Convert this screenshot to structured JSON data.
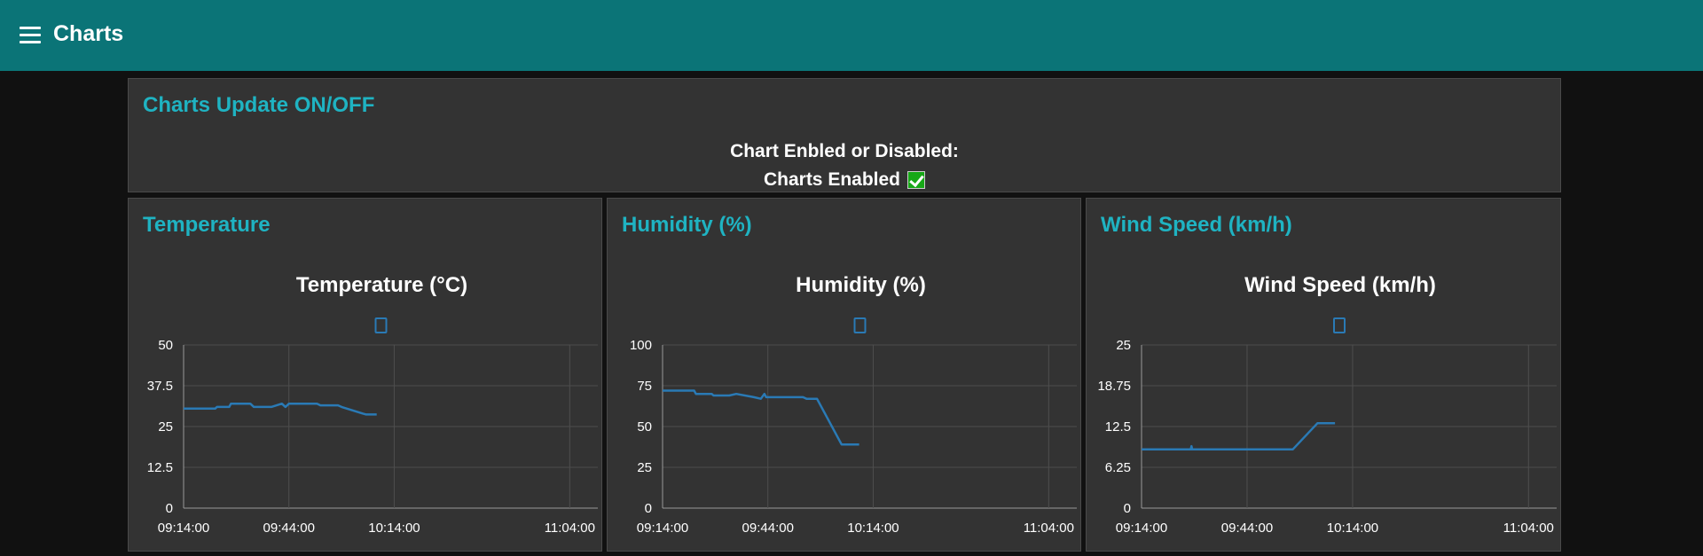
{
  "header": {
    "title": "Charts"
  },
  "toggle_card": {
    "title": "Charts Update ON/OFF",
    "status_label": "Chart Enbled or Disabled:",
    "status_value": "Charts Enabled"
  },
  "colors": {
    "header_bg": "#0b7477",
    "accent": "#1fb3c2",
    "series": "#2a7ab5",
    "card_bg": "#333333"
  },
  "chart_data": [
    {
      "type": "line",
      "card_title": "Temperature",
      "title": "Temperature (°C)",
      "legend": "top-center",
      "x_ticks": [
        "09:14:00",
        "09:44:00",
        "10:14:00",
        "11:04:00"
      ],
      "x_tick_minutes": [
        0,
        30,
        60,
        110
      ],
      "x_range_minutes": [
        0,
        118
      ],
      "y_ticks": [
        "0",
        "12.5",
        "25",
        "37.5",
        "50"
      ],
      "ylim": [
        0,
        50
      ],
      "grid": true,
      "series": [
        {
          "x": [
            0,
            9,
            9.5,
            13,
            13.5,
            19,
            20,
            25,
            28,
            29,
            29.5,
            30,
            38,
            39,
            44,
            45,
            51,
            52,
            55
          ],
          "y": [
            30.5,
            30.5,
            31,
            31,
            32,
            32,
            31,
            31,
            32,
            31,
            31.5,
            32,
            32,
            31.5,
            31.5,
            31,
            29,
            28.7,
            28.7
          ]
        }
      ]
    },
    {
      "type": "line",
      "card_title": "Humidity (%)",
      "title": "Humidity (%)",
      "legend": "top-center",
      "x_ticks": [
        "09:14:00",
        "09:44:00",
        "10:14:00",
        "11:04:00"
      ],
      "x_tick_minutes": [
        0,
        30,
        60,
        110
      ],
      "x_range_minutes": [
        0,
        118
      ],
      "y_ticks": [
        "0",
        "25",
        "50",
        "75",
        "100"
      ],
      "ylim": [
        0,
        100
      ],
      "grid": true,
      "series": [
        {
          "x": [
            0,
            9,
            9.5,
            14,
            14.5,
            19,
            21,
            26,
            28,
            29,
            29.5,
            40,
            41,
            44,
            51,
            56
          ],
          "y": [
            72,
            72,
            70,
            70,
            69,
            69,
            70,
            68,
            67,
            70,
            68,
            68,
            67,
            67,
            39,
            39
          ]
        }
      ]
    },
    {
      "type": "line",
      "card_title": "Wind Speed (km/h)",
      "title": "Wind Speed (km/h)",
      "legend": "top-center",
      "x_ticks": [
        "09:14:00",
        "09:44:00",
        "10:14:00",
        "11:04:00"
      ],
      "x_tick_minutes": [
        0,
        30,
        60,
        110
      ],
      "x_range_minutes": [
        0,
        118
      ],
      "y_ticks": [
        "0",
        "6.25",
        "12.5",
        "18.75",
        "25"
      ],
      "ylim": [
        0,
        25
      ],
      "grid": true,
      "series": [
        {
          "x": [
            0,
            14,
            14.2,
            14.4,
            43,
            50,
            55
          ],
          "y": [
            9,
            9,
            9.5,
            9,
            9,
            13,
            13
          ]
        }
      ]
    }
  ]
}
